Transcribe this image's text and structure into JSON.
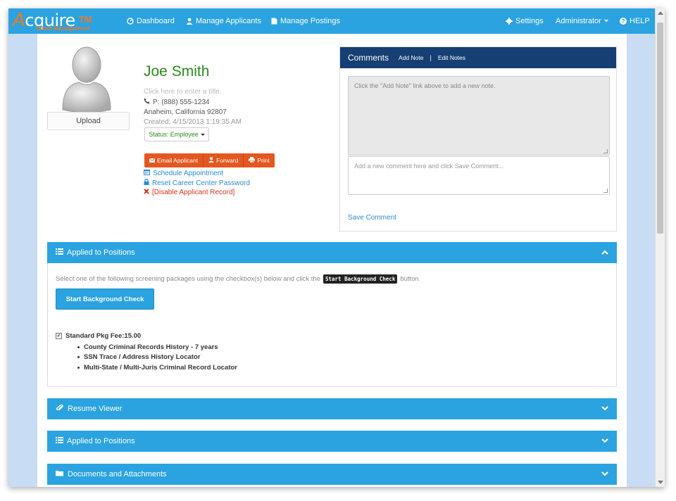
{
  "brand": {
    "name": "cquire",
    "initial": "A",
    "tm": "TM",
    "tagline": "Talent Management"
  },
  "nav": {
    "dashboard": "Dashboard",
    "manage_applicants": "Manage Applicants",
    "manage_postings": "Manage Postings",
    "settings": "Settings",
    "user": "Administrator",
    "help": "HELP"
  },
  "profile": {
    "upload_label": "Upload",
    "name": "Joe Smith",
    "title_placeholder": "Click here to enter a title.",
    "phone": "P: (888) 555-1234",
    "location": "Anaheim, California 92807",
    "created": "Created: 4/15/2013 1:19:35 AM",
    "status": "Status: Employee",
    "actions": {
      "email": "Email Applicant",
      "forward": "Forward",
      "print": "Print"
    },
    "links": {
      "schedule": "Schedule Appointment",
      "reset": "Reset Career Center Password",
      "disable": "[Disable Applicant Record]"
    }
  },
  "comments": {
    "title": "Comments",
    "add_note": "Add Note",
    "separator": "|",
    "edit_notes": "Edit Notes",
    "note_placeholder": "Click the \"Add Note\" link above to add a new note.",
    "comment_placeholder": "Add a new comment here and click Save Comment...",
    "save": "Save Comment"
  },
  "sections": {
    "applied_positions": "Applied to Positions",
    "resume_viewer": "Resume Viewer",
    "applied_positions_2": "Applied to Positions",
    "documents": "Documents and Attachments"
  },
  "screening": {
    "instr_before": "Select one of the following screening packages using the checkbox(s) below and click the",
    "instr_code": "Start Background Check",
    "instr_after": "button",
    "button": "Start Background Check",
    "package": "Standard Pkg Fee:15.00",
    "package_checked": true,
    "items": [
      "County Criminal Records History - 7 years",
      "SSN Trace / Address History Locator",
      "Multi-State / Multi-Juris Criminal Record Locator"
    ]
  },
  "colors": {
    "navbar": "#2aa3e0",
    "brand_orange": "#f0791f",
    "name_green": "#2b8a1c",
    "comments_header": "#163f73",
    "action_orange": "#e4571f",
    "link_blue": "#2a8ad4",
    "link_red": "#d8331f"
  }
}
